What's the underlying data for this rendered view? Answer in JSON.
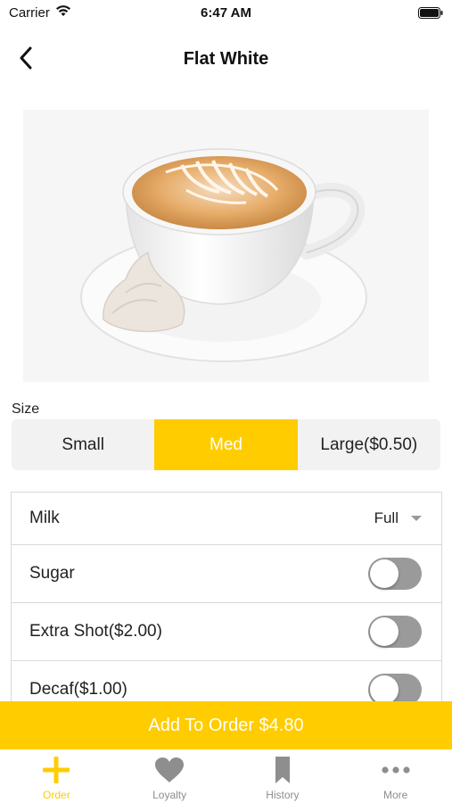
{
  "status_bar": {
    "carrier": "Carrier",
    "time": "6:47 AM"
  },
  "nav": {
    "title": "Flat White",
    "back_icon": "chevron-left-icon"
  },
  "product": {
    "image_icon": "coffee-cup-image"
  },
  "size": {
    "label": "Size",
    "options": [
      "Small",
      "Med",
      "Large($0.50)"
    ],
    "selected": "Med"
  },
  "options": {
    "milk": {
      "label": "Milk",
      "value": "Full"
    },
    "sugar": {
      "label": "Sugar",
      "on": false
    },
    "extra_shot": {
      "label": "Extra Shot($2.00)",
      "on": false
    },
    "decaf": {
      "label": "Decaf($1.00)",
      "on": false
    }
  },
  "add_to_order": {
    "label": "Add To Order $4.80"
  },
  "tabs": [
    {
      "label": "Order",
      "icon": "plus-icon",
      "active": true
    },
    {
      "label": "Loyalty",
      "icon": "heart-icon",
      "active": false
    },
    {
      "label": "History",
      "icon": "bookmark-icon",
      "active": false
    },
    {
      "label": "More",
      "icon": "more-icon",
      "active": false
    }
  ],
  "colors": {
    "accent": "#ffcc00",
    "toggle_off": "#9a9a9a",
    "tab_inactive": "#8e8e8e"
  }
}
